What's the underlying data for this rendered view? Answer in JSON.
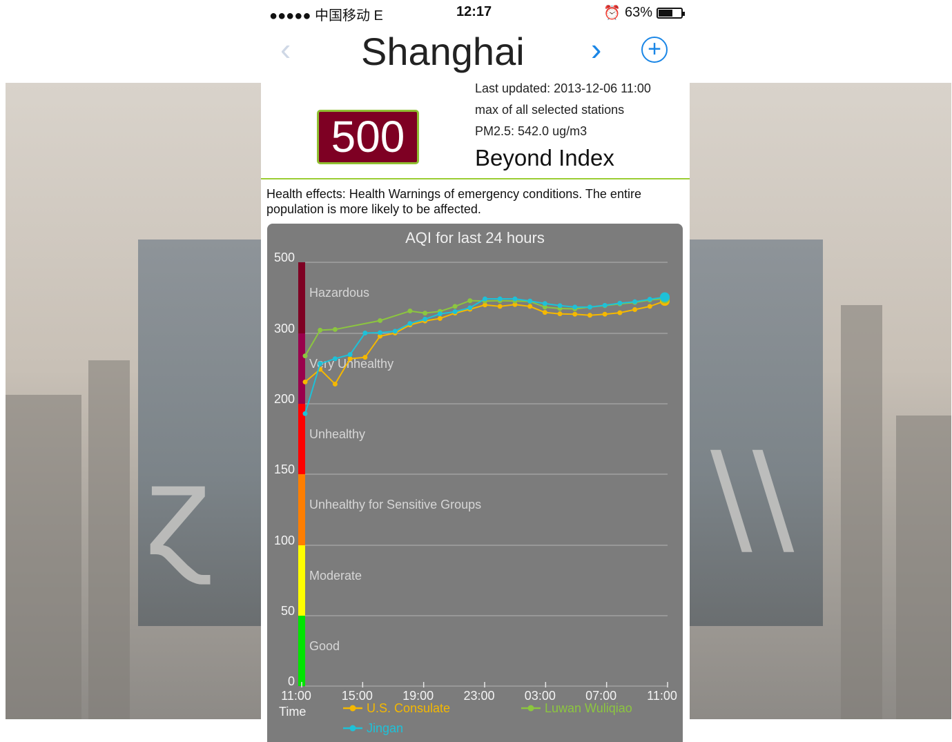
{
  "status_bar": {
    "carrier": "●●●●● 中国移动  E",
    "time": "12:17",
    "alarm_icon": "alarm-clock-icon",
    "battery_percent": "63%",
    "battery_level": 0.63
  },
  "nav": {
    "prev_icon": "chevron-left-icon",
    "title": "Shanghai",
    "next_icon": "chevron-right-icon",
    "add_icon": "plus-circle-icon",
    "prev_glyph": "‹",
    "next_glyph": "›",
    "add_glyph": "+"
  },
  "aqi": {
    "value": "500",
    "box_color": "#7e0023"
  },
  "info": {
    "last_updated": "Last updated: 2013-12-06 11:00",
    "source": "max of all selected stations",
    "pm25": "PM2.5: 542.0 ug/m3"
  },
  "level_label": "Beyond Index",
  "health_text": "Health effects: Health Warnings of emergency conditions. The entire population is more likely to be affected.",
  "colors": {
    "accent": "#1a86e6",
    "divider": "#9acd32"
  },
  "chart_data": {
    "type": "line",
    "title": "AQI for last 24 hours",
    "xlabel": "Time",
    "y_ticks": [
      "500",
      "300",
      "200",
      "150",
      "100",
      "50",
      "0"
    ],
    "x_ticks": [
      "11:00",
      "15:00",
      "19:00",
      "23:00",
      "03:00",
      "07:00",
      "11:00"
    ],
    "bands": [
      {
        "label": "Hazardous",
        "from": 300,
        "to": 500,
        "color": "#7e0023"
      },
      {
        "label": "Very Unhealthy",
        "from": 200,
        "to": 300,
        "color": "#99004c"
      },
      {
        "label": "Unhealthy",
        "from": 150,
        "to": 200,
        "color": "#ff0000"
      },
      {
        "label": "Unhealthy for Sensitive Groups",
        "from": 100,
        "to": 150,
        "color": "#ff7e00"
      },
      {
        "label": "Moderate",
        "from": 50,
        "to": 100,
        "color": "#ffff00"
      },
      {
        "label": "Good",
        "from": 0,
        "to": 50,
        "color": "#00e400"
      }
    ],
    "series": [
      {
        "name": "U.S. Consulate",
        "color": "#f5b800",
        "values": [
          231,
          249,
          228,
          264,
          266,
          296,
          301,
          324,
          335,
          342,
          357,
          368,
          380,
          376,
          381,
          376,
          359,
          355,
          354,
          351,
          354,
          358,
          367,
          376,
          391
        ]
      },
      {
        "name": "Luwan Wuliqiao",
        "color": "#8cc63f",
        "values": [
          268,
          309,
          311,
          null,
          null,
          336,
          null,
          363,
          357,
          362,
          376,
          392,
          391,
          392,
          391,
          390,
          374,
          370,
          369,
          374,
          378,
          383,
          387,
          394,
          398
        ]
      },
      {
        "name": "Jingan",
        "color": "#1ec1d8",
        "values": [
          193,
          257,
          264,
          270,
          301,
          302,
          306,
          328,
          340,
          355,
          361,
          372,
          397,
          397,
          397,
          391,
          384,
          378,
          374,
          374,
          379,
          385,
          389,
          396,
          402
        ]
      }
    ]
  }
}
